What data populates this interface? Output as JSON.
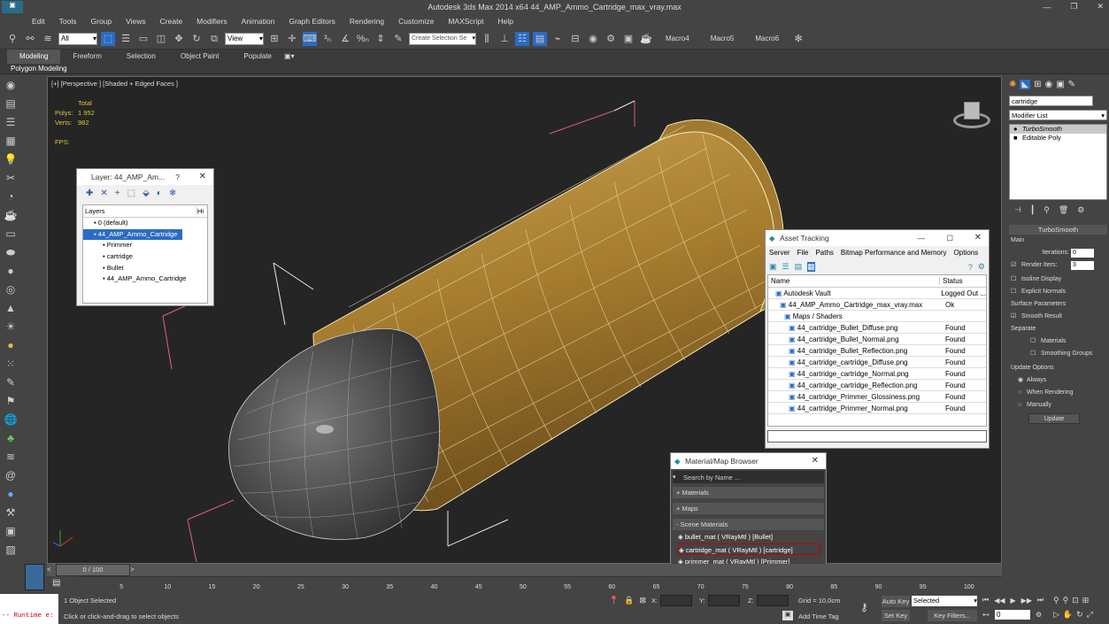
{
  "window": {
    "title": "Autodesk 3ds Max  2014 x64     44_AMP_Ammo_Cartridge_max_vray.max"
  },
  "menu": [
    "Edit",
    "Tools",
    "Group",
    "Views",
    "Create",
    "Modifiers",
    "Animation",
    "Graph Editors",
    "Rendering",
    "Customize",
    "MAXScript",
    "Help"
  ],
  "toolbar": {
    "filter_value": "All",
    "view_value": "View",
    "selection_set_placeholder": "Create Selection Se",
    "macros": [
      "Macro4",
      "Macro5",
      "Macro6"
    ]
  },
  "ribbon": {
    "tabs": [
      "Modeling",
      "Freeform",
      "Selection",
      "Object Paint",
      "Populate"
    ],
    "sub": "Polygon Modeling"
  },
  "viewport": {
    "label": "[+] [Perspective ] [Shaded + Edged Faces ]",
    "stats_header": "Total",
    "polys_label": "Polys:",
    "polys_value": "1 952",
    "verts_label": "Verts:",
    "verts_value": "982",
    "fps_label": "FPS:"
  },
  "layer_dialog": {
    "title": "Layer: 44_AMP_Am...",
    "help": "?",
    "col_layers": "Layers",
    "col_hide": "Hi",
    "items": [
      {
        "label": "0 (default)",
        "indent": 0,
        "selected": false
      },
      {
        "label": "44_AMP_Ammo_Cartridge",
        "indent": 0,
        "selected": true
      },
      {
        "label": "Primmer",
        "indent": 1,
        "selected": false
      },
      {
        "label": "cartridge",
        "indent": 1,
        "selected": false
      },
      {
        "label": "Bullet",
        "indent": 1,
        "selected": false
      },
      {
        "label": "44_AMP_Ammo_Cartridge",
        "indent": 1,
        "selected": false
      }
    ]
  },
  "asset_tracking": {
    "title": "Asset Tracking",
    "menu": [
      "Server",
      "File",
      "Paths",
      "Bitmap Performance and Memory",
      "Options"
    ],
    "col_name": "Name",
    "col_status": "Status",
    "rows": [
      {
        "name": "Autodesk Vault",
        "status": "Logged Out ...",
        "indent": 1
      },
      {
        "name": "44_AMP_Ammo_Cartridge_max_vray.max",
        "status": "Ok",
        "indent": 2
      },
      {
        "name": "Maps / Shaders",
        "status": "",
        "indent": 3
      },
      {
        "name": "44_cartridge_Bullet_Diffuse.png",
        "status": "Found",
        "indent": 4
      },
      {
        "name": "44_cartridge_Bullet_Normal.png",
        "status": "Found",
        "indent": 4
      },
      {
        "name": "44_cartridge_Bullet_Reflection.png",
        "status": "Found",
        "indent": 4
      },
      {
        "name": "44_cartridge_cartridge_Diffuse.png",
        "status": "Found",
        "indent": 4
      },
      {
        "name": "44_cartridge_cartridge_Normal.png",
        "status": "Found",
        "indent": 4
      },
      {
        "name": "44_cartridge_cartridge_Reflection.png",
        "status": "Found",
        "indent": 4
      },
      {
        "name": "44_cartridge_Primmer_Glossiness.png",
        "status": "Found",
        "indent": 4
      },
      {
        "name": "44_cartridge_Primmer_Normal.png",
        "status": "Found",
        "indent": 4
      }
    ]
  },
  "material_browser": {
    "title": "Material/Map Browser",
    "search_placeholder": "Search by Name ...",
    "groups": [
      "+ Materials",
      "+ Maps",
      "- Scene Materials"
    ],
    "materials": [
      {
        "label": "bullet_mat  ( VRayMtl ) [Bullet]",
        "selected": false
      },
      {
        "label": "cartridge_mat  ( VRayMtl ) [cartridge]",
        "selected": true
      },
      {
        "label": "primmer_mat  ( VRayMtl ) [Primmer]",
        "selected": false
      }
    ]
  },
  "command_panel": {
    "object_name": "cartridge",
    "modifier_list": "Modifier List",
    "stack": [
      "TurboSmooth",
      "Editable Poly"
    ],
    "rollout_title": "TurboSmooth",
    "main_label": "Main",
    "iterations_label": "Iterations:",
    "iterations_value": "0",
    "render_iters_label": "Render Iters:",
    "render_iters_value": "3",
    "isoline": "Isoline Display",
    "explicit": "Explicit Normals",
    "surface_params": "Surface Parameters",
    "smooth_result": "Smooth Result",
    "separate": "Separate",
    "materials": "Materials",
    "smoothing_groups": "Smoothing Groups",
    "update_options": "Update Options",
    "always": "Always",
    "when_rendering": "When Rendering",
    "manually": "Manually",
    "update_button": "Update"
  },
  "timeline": {
    "frame": "0 / 100",
    "ticks": [
      "5",
      "10",
      "15",
      "20",
      "25",
      "30",
      "35",
      "40",
      "45",
      "50",
      "55",
      "60",
      "65",
      "70",
      "75",
      "80",
      "85",
      "90",
      "95",
      "100"
    ]
  },
  "status": {
    "script": "-- Runtime e:",
    "selected": "1 Object Selected",
    "prompt": "Click or click-and-drag to select objects",
    "x_label": "X:",
    "y_label": "Y:",
    "z_label": "Z:",
    "grid": "Grid = 10,0cm",
    "add_time_tag": "Add Time Tag",
    "auto_key": "Auto Key",
    "selected_dropdown": "Selected",
    "set_key": "Set Key",
    "key_filters": "Key Filters...",
    "frame_value": "0"
  },
  "colors": {
    "accent": "#1e5fbf",
    "selection_red": "#c00000",
    "brass": "#b88a3a"
  }
}
